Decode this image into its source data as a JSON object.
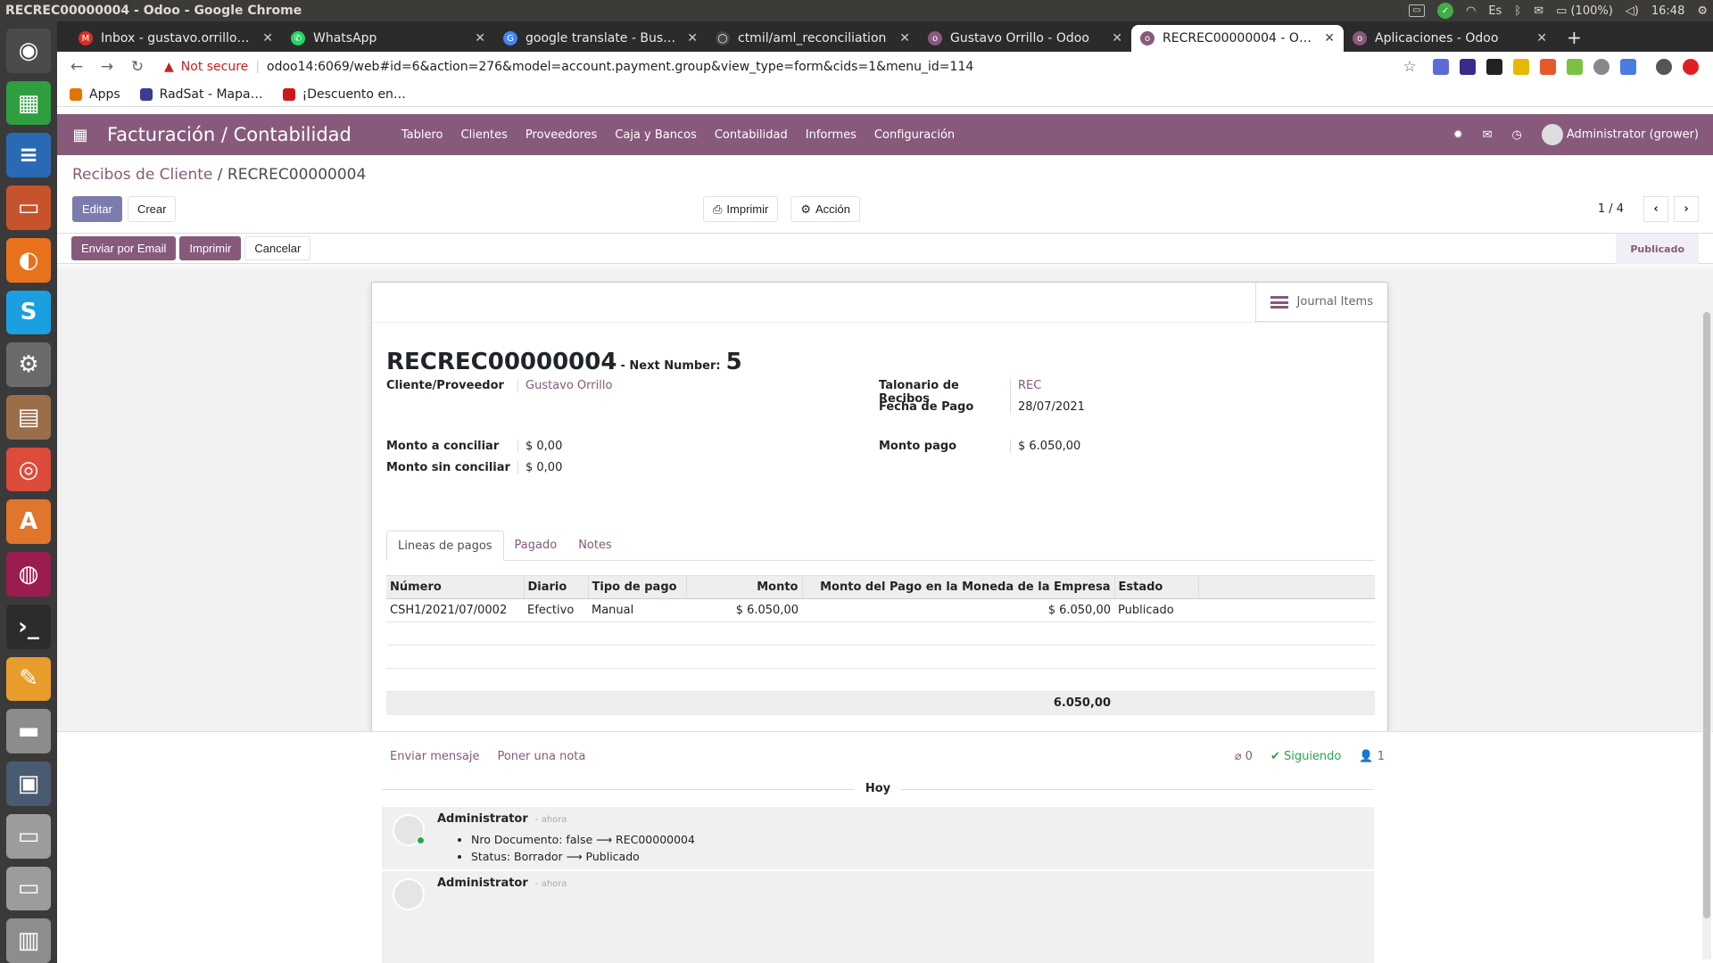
{
  "os": {
    "window_title": "RECREC00000004 - Odoo - Google Chrome",
    "tray": {
      "keyboard": "Es",
      "battery": "(100%)",
      "clock": "16:48"
    },
    "launcher": [
      {
        "name": "ubuntu-logo-icon",
        "color": "#4b4b4b",
        "glyph": "◉"
      },
      {
        "name": "spreadsheet-icon",
        "color": "#2e9e3e",
        "glyph": "▦"
      },
      {
        "name": "document-icon",
        "color": "#2a6ab5",
        "glyph": "≡"
      },
      {
        "name": "presentation-icon",
        "color": "#c7532c",
        "glyph": "▭"
      },
      {
        "name": "firefox-icon",
        "color": "#e8721c",
        "glyph": "◐"
      },
      {
        "name": "skype-icon",
        "color": "#1a9fe0",
        "glyph": "S"
      },
      {
        "name": "settings-icon",
        "color": "#6b6b6b",
        "glyph": "⚙"
      },
      {
        "name": "archive-icon",
        "color": "#9a6e49",
        "glyph": "▤"
      },
      {
        "name": "chrome-icon",
        "color": "#dd4b39",
        "glyph": "◎"
      },
      {
        "name": "software-center-icon",
        "color": "#e0762b",
        "glyph": "A"
      },
      {
        "name": "disc-icon",
        "color": "#9a1d4f",
        "glyph": "◍"
      },
      {
        "name": "terminal-icon",
        "color": "#2c2c2c",
        "glyph": "›_"
      },
      {
        "name": "text-editor-icon",
        "color": "#e89c2b",
        "glyph": "✎"
      },
      {
        "name": "scanner-icon",
        "color": "#8c8c8c",
        "glyph": "▬"
      },
      {
        "name": "workspace-icon",
        "color": "#4a5a70",
        "glyph": "▣"
      },
      {
        "name": "drive-icon",
        "color": "#9c9c9c",
        "glyph": "▭"
      },
      {
        "name": "drive-icon-2",
        "color": "#9c9c9c",
        "glyph": "▭"
      },
      {
        "name": "trash-icon",
        "color": "#8d8d8d",
        "glyph": "▥"
      }
    ]
  },
  "browser": {
    "tabs": [
      {
        "label": "Inbox - gustavo.orrillo@g",
        "fav_color": "#d93025",
        "fav_glyph": "M"
      },
      {
        "label": "WhatsApp",
        "fav_color": "#25d366",
        "fav_glyph": "✆"
      },
      {
        "label": "google translate - Buscar",
        "fav_color": "#4285f4",
        "fav_glyph": "G"
      },
      {
        "label": "ctmil/aml_reconciliation",
        "fav_color": "#444444",
        "fav_glyph": "◯"
      },
      {
        "label": "Gustavo Orrillo - Odoo",
        "fav_color": "#875a7b",
        "fav_glyph": "o"
      },
      {
        "label": "RECREC00000004 - Odoo",
        "fav_color": "#875a7b",
        "fav_glyph": "o",
        "active": true
      },
      {
        "label": "Aplicaciones - Odoo",
        "fav_color": "#875a7b",
        "fav_glyph": "o"
      }
    ],
    "not_secure": "Not secure",
    "url": "odoo14:6069/web#id=6&action=276&model=account.payment.group&view_type=form&cids=1&menu_id=114",
    "bookmarks": [
      {
        "label": "Apps",
        "color": "#e37400"
      },
      {
        "label": "RadSat - Mapa…",
        "color": "#3b3b8f"
      },
      {
        "label": "¡Descuento en…",
        "color": "#cc1a1a"
      }
    ]
  },
  "odoo": {
    "app_title": "Facturación / Contabilidad",
    "menu": [
      "Tablero",
      "Clientes",
      "Proveedores",
      "Caja y Bancos",
      "Contabilidad",
      "Informes",
      "Configuración"
    ],
    "user": "Administrator (grower)",
    "breadcrumb": {
      "parent": "Recibos de Cliente",
      "current": "RECREC00000004"
    },
    "buttons": {
      "edit": "Editar",
      "create": "Crear",
      "print": "Imprimir",
      "action": "Acción"
    },
    "pager": {
      "value": "1 / 4"
    },
    "status_buttons": {
      "email": "Enviar por Email",
      "print": "Imprimir",
      "cancel": "Cancelar"
    },
    "state": "Publicado",
    "smart_button": "Journal Items",
    "record": {
      "name": "RECREC00000004",
      "next_number_label": "- Next Number:",
      "next_number": "5",
      "partner_label": "Cliente/Proveedor",
      "partner": "Gustavo Orrillo",
      "receiptbook_label": "Talonario de Recibos",
      "receiptbook": "REC",
      "date_label": "Fecha de Pago",
      "date": "28/07/2021",
      "to_reconcile_label": "Monto a conciliar",
      "to_reconcile": "$ 0,00",
      "unreconciled_label": "Monto sin conciliar",
      "unreconciled": "$ 0,00",
      "amount_label": "Monto pago",
      "amount": "$ 6.050,00"
    },
    "tabs": [
      "Lineas de pagos",
      "Pagado",
      "Notes"
    ],
    "lines": {
      "headers": [
        "Número",
        "Diario",
        "Tipo de pago",
        "Monto",
        "Monto del Pago en la Moneda de la Empresa",
        "Estado"
      ],
      "rows": [
        [
          "CSH1/2021/07/0002",
          "Efectivo",
          "Manual",
          "$ 6.050,00",
          "$ 6.050,00",
          "Publicado"
        ]
      ],
      "total": "6.050,00"
    },
    "chatter": {
      "send_message": "Enviar mensaje",
      "log_note": "Poner una nota",
      "attachments": "0",
      "following": "Siguiendo",
      "followers": "1",
      "day": "Hoy",
      "messages": [
        {
          "author": "Administrator",
          "date": "- ahora",
          "changes": [
            "Nro Documento: false ⟶ REC00000004",
            "Status: Borrador ⟶ Publicado"
          ]
        },
        {
          "author": "Administrator",
          "date": "- ahora",
          "changes": []
        }
      ]
    }
  }
}
